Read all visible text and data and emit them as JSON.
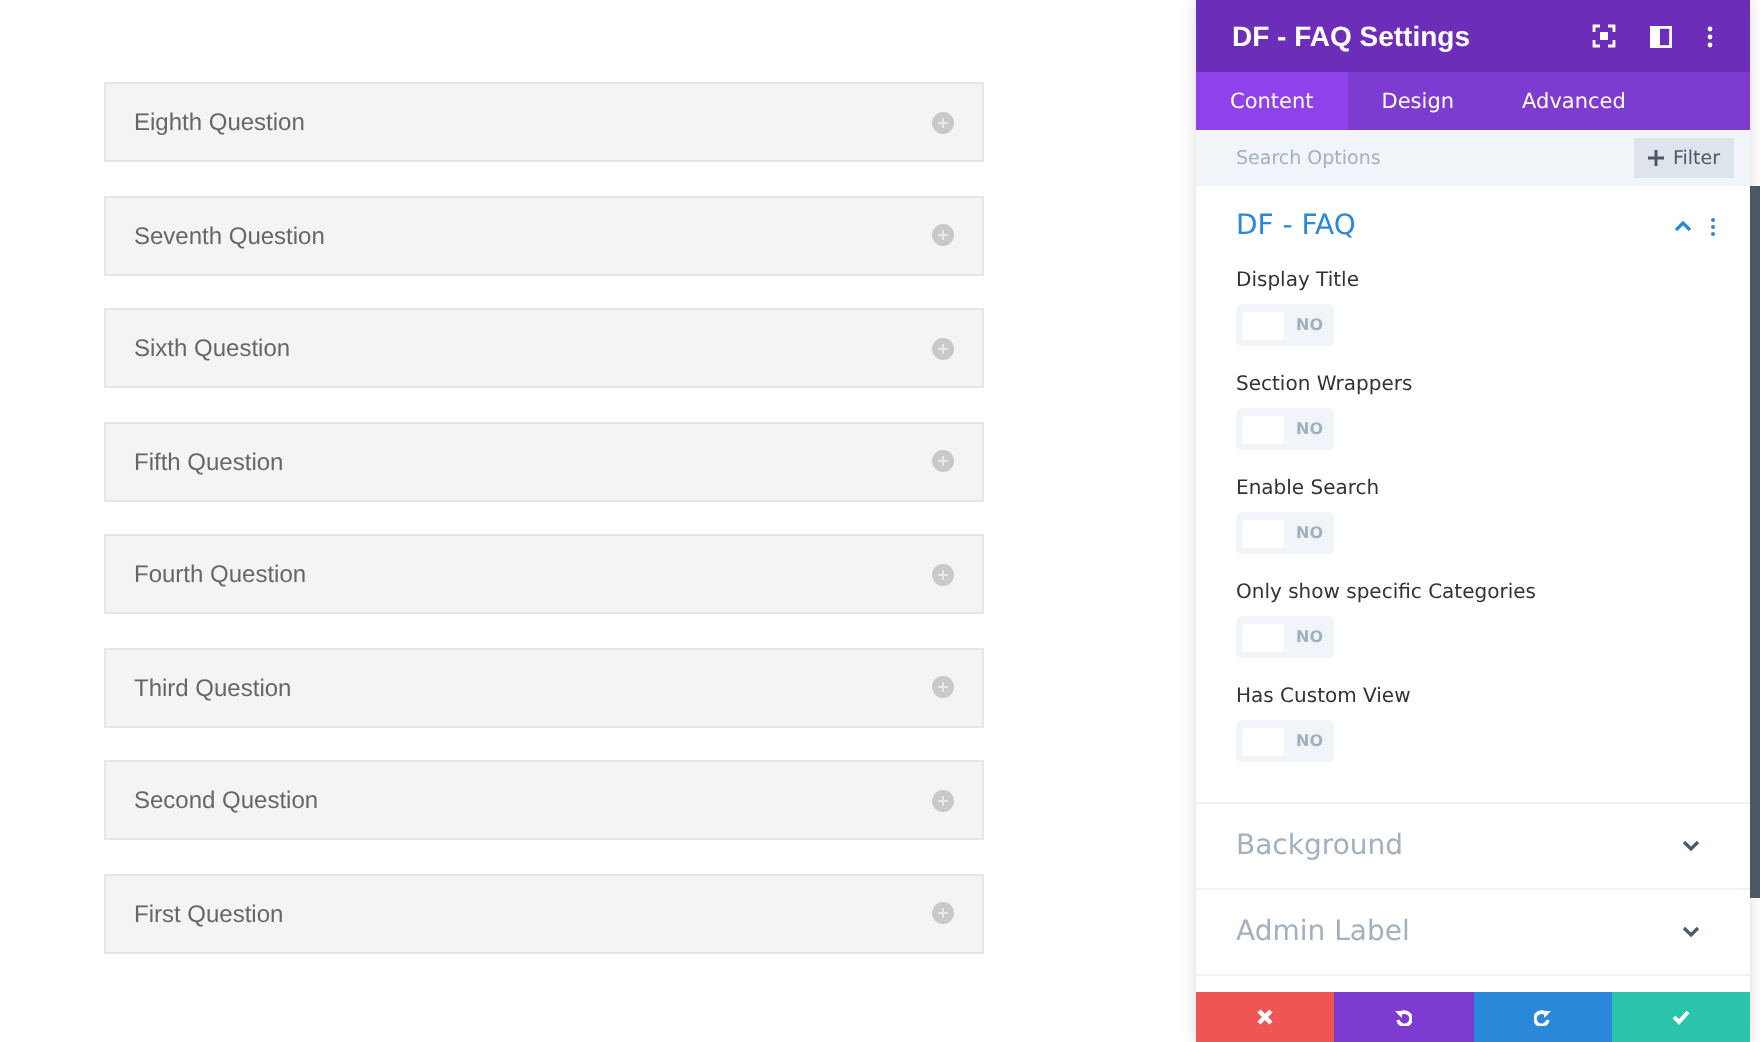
{
  "faq_items": [
    {
      "question": "Eighth Question",
      "expanded": false
    },
    {
      "question": "Seventh Question",
      "expanded": false
    },
    {
      "question": "Sixth Question",
      "expanded": false
    },
    {
      "question": "Fifth Question",
      "expanded": false
    },
    {
      "question": "Fourth Question",
      "expanded": false
    },
    {
      "question": "Third Question",
      "expanded": false
    },
    {
      "question": "Second Question",
      "expanded": false
    },
    {
      "question": "First Question",
      "expanded": false
    }
  ],
  "panel": {
    "title": "DF - FAQ Settings",
    "tabs": [
      {
        "label": "Content",
        "selected": true
      },
      {
        "label": "Design",
        "selected": false
      },
      {
        "label": "Advanced",
        "selected": false
      }
    ],
    "search": {
      "placeholder": "Search Options"
    },
    "filter_button": "Filter",
    "sections": [
      {
        "title": "DF - FAQ",
        "expanded": true,
        "options": [
          {
            "label": "Display Title",
            "on": false,
            "state": "NO"
          },
          {
            "label": "Section Wrappers",
            "on": false,
            "state": "NO"
          },
          {
            "label": "Enable Search",
            "on": false,
            "state": "NO"
          },
          {
            "label": "Only show specific Categories",
            "on": false,
            "state": "NO"
          },
          {
            "label": "Has Custom View",
            "on": false,
            "state": "NO"
          }
        ]
      },
      {
        "title": "Background",
        "expanded": false
      },
      {
        "title": "Admin Label",
        "expanded": false
      }
    ],
    "actions": [
      {
        "kind": "cancel"
      },
      {
        "kind": "undo"
      },
      {
        "kind": "redo"
      },
      {
        "kind": "save"
      }
    ]
  }
}
